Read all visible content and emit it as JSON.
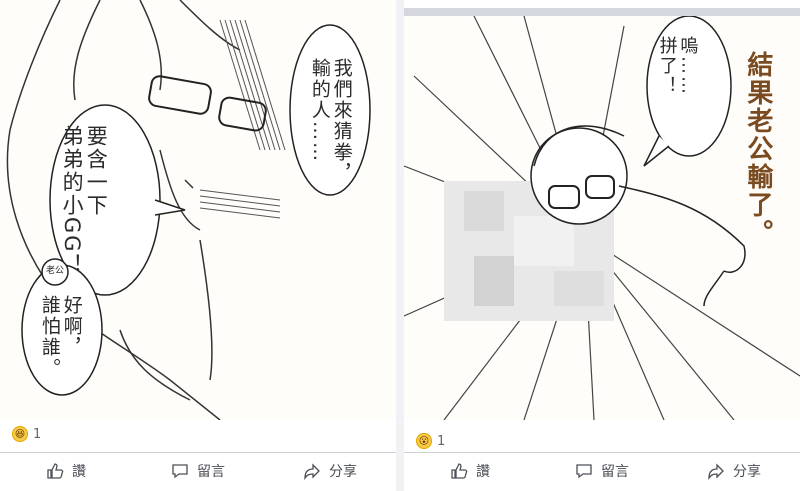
{
  "left_post": {
    "comic": {
      "bubble_top": "我們來猜拳，\n輸的人……",
      "bubble_middle": "要含一下\n弟弟的小GG！",
      "badge": "老公",
      "bubble_bottom": "好啊，\n誰怕誰。"
    },
    "reaction": {
      "icon": "laugh-emoji",
      "count": "1"
    },
    "actions": {
      "like": "讚",
      "comment": "留言",
      "share": "分享"
    }
  },
  "right_post": {
    "comic": {
      "caption": "結果老公輸了。",
      "bubble": "嗚……\n拼了！"
    },
    "reaction": {
      "icon": "wow-emoji",
      "count": "1"
    },
    "actions": {
      "like": "讚",
      "comment": "留言",
      "share": "分享"
    }
  }
}
